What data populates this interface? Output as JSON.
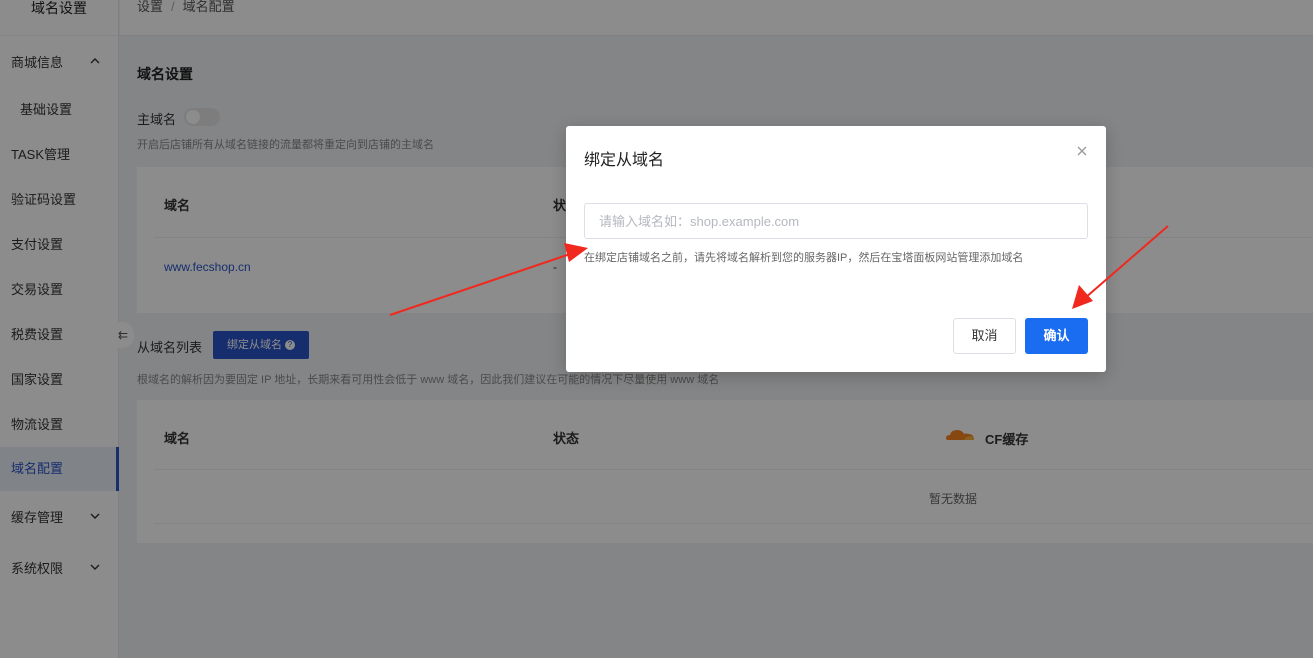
{
  "sidebar": {
    "top_label": "域名设置",
    "items": [
      {
        "label": "商城信息",
        "chevron": "up"
      },
      {
        "label": "基础设置"
      },
      {
        "label": "TASK管理"
      },
      {
        "label": "验证码设置"
      },
      {
        "label": "支付设置"
      },
      {
        "label": "交易设置"
      },
      {
        "label": "税费设置"
      },
      {
        "label": "国家设置"
      },
      {
        "label": "物流设置"
      },
      {
        "label": "域名配置",
        "active": true
      },
      {
        "label": "缓存管理",
        "chevron": "down"
      },
      {
        "label": "系统权限",
        "chevron": "down"
      }
    ],
    "collapse_icon": "collapse-icon"
  },
  "header": {
    "breadcrumb": [
      "设置",
      "域名配置"
    ],
    "separator": "/"
  },
  "main_domain": {
    "title": "域名设置",
    "switch_label": "主域名",
    "switch_on": false,
    "hint": "开启后店铺所有从域名链接的流量都将重定向到店铺的主域名",
    "table_headers": [
      "域名",
      "状"
    ],
    "rows": [
      {
        "domain": "www.fecshop.cn",
        "status": "-"
      }
    ]
  },
  "sub_domains": {
    "title": "从域名列表",
    "bind_button": "绑定从域名",
    "bind_button_icon": "help-icon",
    "hint": "根域名的解析因为要固定 IP 地址，长期来看可用性会低于 www 域名，因此我们建议在可能的情况下尽量使用 www 域名",
    "table_headers": [
      "域名",
      "状态",
      "CF缓存"
    ],
    "empty_text": "暂无数据"
  },
  "modal": {
    "title": "绑定从域名",
    "close_icon": "close-icon",
    "input_placeholder": "请输入域名如：shop.example.com",
    "input_value": "",
    "tip": "在绑定店铺域名之前，请先将域名解析到您的服务器IP，然后在宝塔面板网站管理添加域名",
    "cancel": "取消",
    "confirm": "确认"
  },
  "colors": {
    "accent": "#2a55c9",
    "confirm": "#1a6cf0",
    "arrow": "#f0281e",
    "cf_orange": "#f48120"
  }
}
